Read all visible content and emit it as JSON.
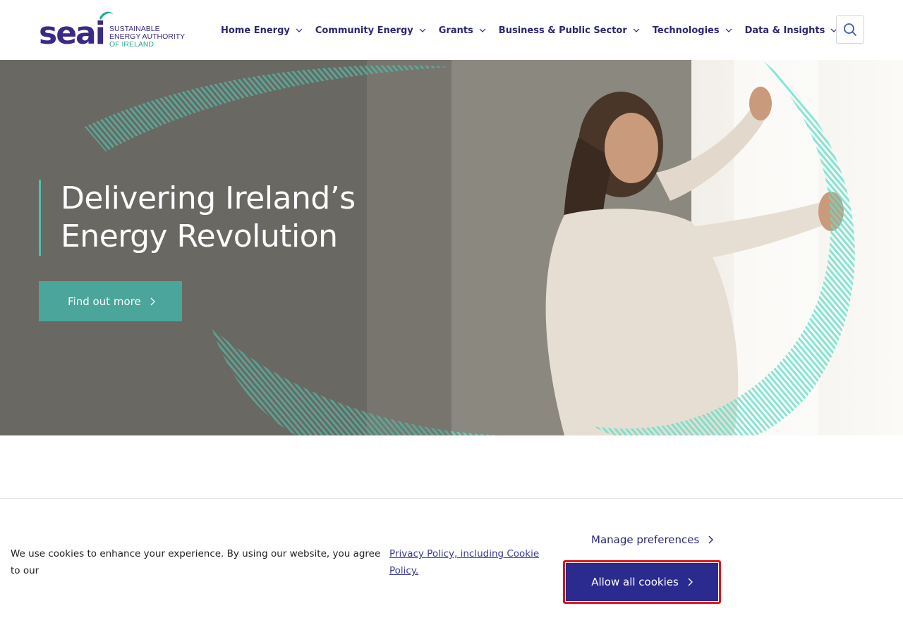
{
  "brand": {
    "logo_word": "seai",
    "tagline_1": "SUSTAINABLE",
    "tagline_2": "ENERGY AUTHORITY",
    "tagline_3": "OF IRELAND",
    "primary_color": "#2c2676",
    "accent_color": "#4ec1b1"
  },
  "nav": {
    "items": [
      {
        "label": "Home Energy"
      },
      {
        "label": "Community Energy"
      },
      {
        "label": "Grants"
      },
      {
        "label": "Business & Public Sector"
      },
      {
        "label": "Technologies"
      },
      {
        "label": "Data & Insights"
      }
    ],
    "search_icon": "search-icon"
  },
  "hero": {
    "title": "Delivering Ireland’s Energy Revolution",
    "cta_label": "Find out more",
    "cta_color": "#4ba59b"
  },
  "cookie": {
    "message": "We use cookies to enhance your experience. By using our website, you agree to our",
    "policy_link": "Privacy Policy, including Cookie Policy.",
    "manage_label": "Manage preferences",
    "allow_label": "Allow all cookies",
    "allow_color": "#2b2a8f",
    "highlight_color": "#e0141a"
  }
}
